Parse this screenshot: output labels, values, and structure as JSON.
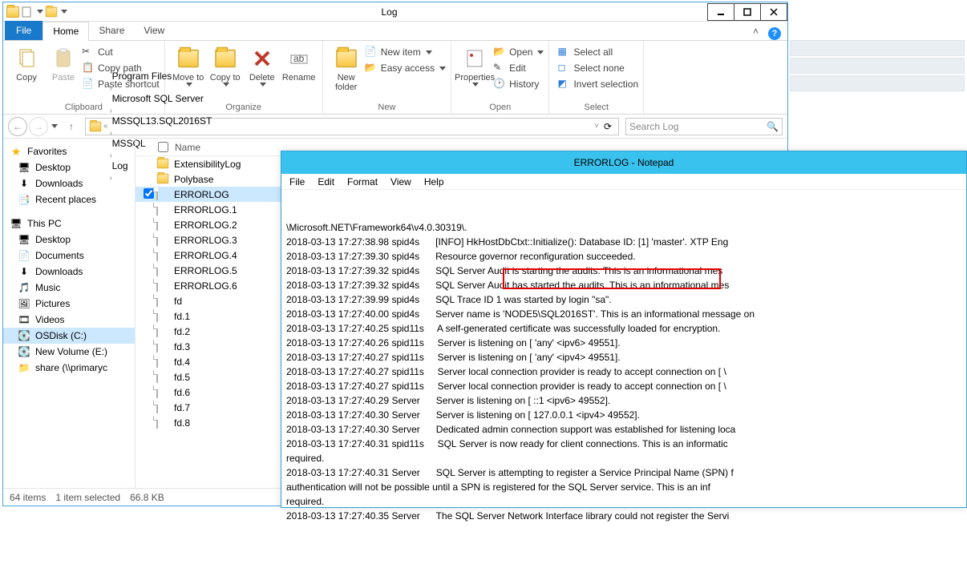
{
  "explorer": {
    "title": "Log",
    "tabs": {
      "file": "File",
      "home": "Home",
      "share": "Share",
      "view": "View"
    },
    "ribbon": {
      "clipboard": {
        "copy": "Copy",
        "paste": "Paste",
        "cut": "Cut",
        "copypath": "Copy path",
        "pasteshortcut": "Paste shortcut",
        "label": "Clipboard"
      },
      "organize": {
        "moveto": "Move\nto",
        "copyto": "Copy\nto",
        "delete": "Delete",
        "rename": "Rename",
        "label": "Organize"
      },
      "new": {
        "newfolder": "New\nfolder",
        "newitem": "New item",
        "easyaccess": "Easy access",
        "label": "New"
      },
      "open": {
        "properties": "Properties",
        "open": "Open",
        "edit": "Edit",
        "history": "History",
        "label": "Open"
      },
      "select": {
        "all": "Select all",
        "none": "Select none",
        "invert": "Invert selection",
        "label": "Select"
      }
    },
    "breadcrumb": [
      "Program Files",
      "Microsoft SQL Server",
      "MSSQL13.SQL2016ST",
      "MSSQL",
      "Log"
    ],
    "search_placeholder": "Search Log",
    "nav": {
      "favorites": "Favorites",
      "fav_items": [
        "Desktop",
        "Downloads",
        "Recent places"
      ],
      "thispc": "This PC",
      "pc_items": [
        "Desktop",
        "Documents",
        "Downloads",
        "Music",
        "Pictures",
        "Videos",
        "OSDisk (C:)",
        "New Volume (E:)",
        "share (\\\\primaryc"
      ]
    },
    "cols": {
      "name": "Name"
    },
    "files": [
      {
        "name": "ExtensibilityLog",
        "type": "folder"
      },
      {
        "name": "Polybase",
        "type": "folder"
      },
      {
        "name": "ERRORLOG",
        "type": "file",
        "selected": true
      },
      {
        "name": "ERRORLOG.1",
        "type": "file"
      },
      {
        "name": "ERRORLOG.2",
        "type": "file"
      },
      {
        "name": "ERRORLOG.3",
        "type": "file"
      },
      {
        "name": "ERRORLOG.4",
        "type": "file"
      },
      {
        "name": "ERRORLOG.5",
        "type": "file"
      },
      {
        "name": "ERRORLOG.6",
        "type": "file"
      },
      {
        "name": "fd",
        "type": "file"
      },
      {
        "name": "fd.1",
        "type": "file"
      },
      {
        "name": "fd.2",
        "type": "file"
      },
      {
        "name": "fd.3",
        "type": "file"
      },
      {
        "name": "fd.4",
        "type": "file"
      },
      {
        "name": "fd.5",
        "type": "file"
      },
      {
        "name": "fd.6",
        "type": "file"
      },
      {
        "name": "fd.7",
        "type": "file"
      },
      {
        "name": "fd.8",
        "type": "file"
      }
    ],
    "status": {
      "items": "64 items",
      "sel": "1 item selected",
      "size": "66.8 KB"
    }
  },
  "notepad": {
    "title": "ERRORLOG - Notepad",
    "menu": [
      "File",
      "Edit",
      "Format",
      "View",
      "Help"
    ],
    "lines": [
      "\\Microsoft.NET\\Framework64\\v4.0.30319\\.",
      "2018-03-13 17:27:38.98 spid4s      [INFO] HkHostDbCtxt::Initialize(): Database ID: [1] 'master'. XTP Eng",
      "2018-03-13 17:27:39.30 spid4s      Resource governor reconfiguration succeeded.",
      "2018-03-13 17:27:39.32 spid4s      SQL Server Audit is starting the audits. This is an informational mes",
      "2018-03-13 17:27:39.32 spid4s      SQL Server Audit has started the audits. This is an informational mes",
      "2018-03-13 17:27:39.99 spid4s      SQL Trace ID 1 was started by login \"sa\".",
      "2018-03-13 17:27:40.00 spid4s      Server name is 'NODE5\\SQL2016ST'. This is an informational message on",
      "2018-03-13 17:27:40.25 spid11s     A self-generated certificate was successfully loaded for encryption.",
      "2018-03-13 17:27:40.26 spid11s     Server is listening on [ 'any' <ipv6> 49551].",
      "2018-03-13 17:27:40.27 spid11s     Server is listening on [ 'any' <ipv4> 49551].",
      "2018-03-13 17:27:40.27 spid11s     Server local connection provider is ready to accept connection on [ \\",
      "2018-03-13 17:27:40.27 spid11s     Server local connection provider is ready to accept connection on [ \\",
      "2018-03-13 17:27:40.29 Server      Server is listening on [ ::1 <ipv6> 49552].",
      "2018-03-13 17:27:40.30 Server      Server is listening on [ 127.0.0.1 <ipv4> 49552].",
      "2018-03-13 17:27:40.30 Server      Dedicated admin connection support was established for listening loca",
      "2018-03-13 17:27:40.31 spid11s     SQL Server is now ready for client connections. This is an informatic",
      "required.",
      "2018-03-13 17:27:40.31 Server      SQL Server is attempting to register a Service Principal Name (SPN) f",
      "authentication will not be possible until a SPN is registered for the SQL Server service. This is an inf",
      "required.",
      "2018-03-13 17:27:40.35 Server      The SQL Server Network Interface library could not register the Servi"
    ]
  }
}
